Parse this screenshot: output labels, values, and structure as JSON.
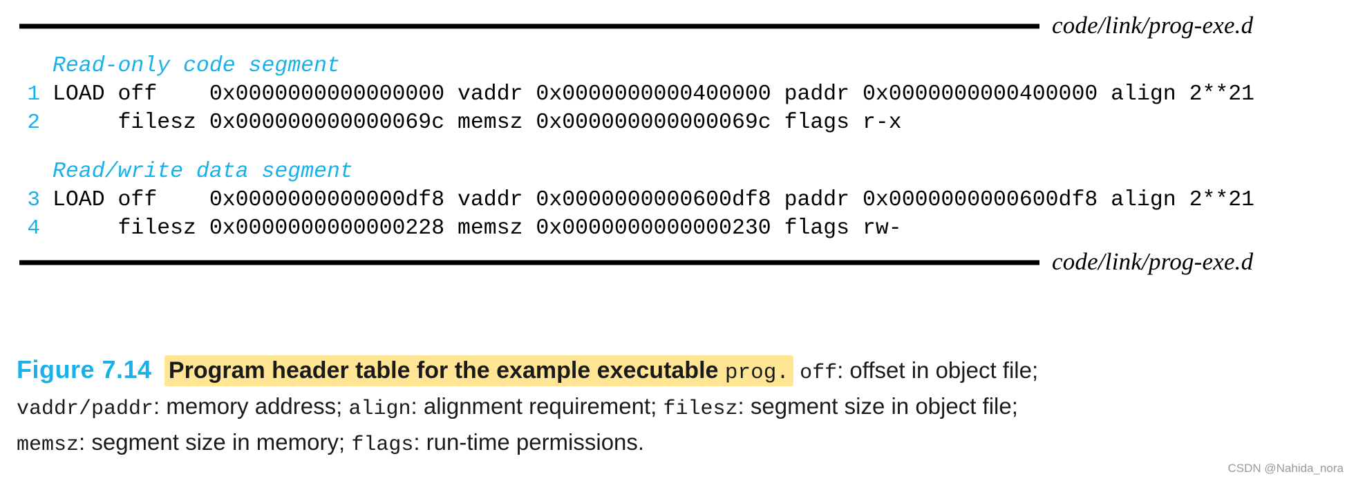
{
  "figure": {
    "top_rule_label": "code/link/prog-exe.d",
    "bottom_rule_label": "code/link/prog-exe.d",
    "code_lines": [
      {
        "num": "",
        "kind": "comment",
        "text": "Read-only code segment"
      },
      {
        "num": "1",
        "kind": "code",
        "text": "LOAD off    0x0000000000000000 vaddr 0x0000000000400000 paddr 0x0000000000400000 align 2**21"
      },
      {
        "num": "2",
        "kind": "code",
        "text": "     filesz 0x000000000000069c memsz 0x000000000000069c flags r-x"
      },
      {
        "num": "",
        "kind": "blank",
        "text": ""
      },
      {
        "num": "",
        "kind": "comment",
        "text": "Read/write data segment"
      },
      {
        "num": "3",
        "kind": "code",
        "text": "LOAD off    0x0000000000000df8 vaddr 0x0000000000600df8 paddr 0x0000000000600df8 align 2**21"
      },
      {
        "num": "4",
        "kind": "code",
        "text": "     filesz 0x0000000000000228 memsz 0x0000000000000230 flags rw-"
      }
    ]
  },
  "caption": {
    "figure_number": "Figure 7.14",
    "highlight_title_part1": "Program header table for the example executable ",
    "highlight_title_mono": "prog.",
    "line1_rest_a": " ",
    "line1_mono_off": "off",
    "line1_text_after_off": ": offset in object file;",
    "line2_mono_vaddr": "vaddr/paddr",
    "line2_text_a": ": memory address; ",
    "line2_mono_align": "align",
    "line2_text_b": ": alignment requirement; ",
    "line2_mono_filesz": "filesz",
    "line2_text_c": ": segment size in object file;",
    "line3_mono_memsz": "memsz",
    "line3_text_a": ": segment size in memory; ",
    "line3_mono_flags": "flags",
    "line3_text_b": ": run-time permissions."
  },
  "watermark": {
    "text": "CSDN @Nahida_nora"
  },
  "colors": {
    "accent_cyan": "#18b2e8",
    "highlight_yellow": "#ffe594",
    "rule_black": "#000000",
    "body_text": "#1a1a1a",
    "watermark_gray": "#9a9a9a"
  }
}
